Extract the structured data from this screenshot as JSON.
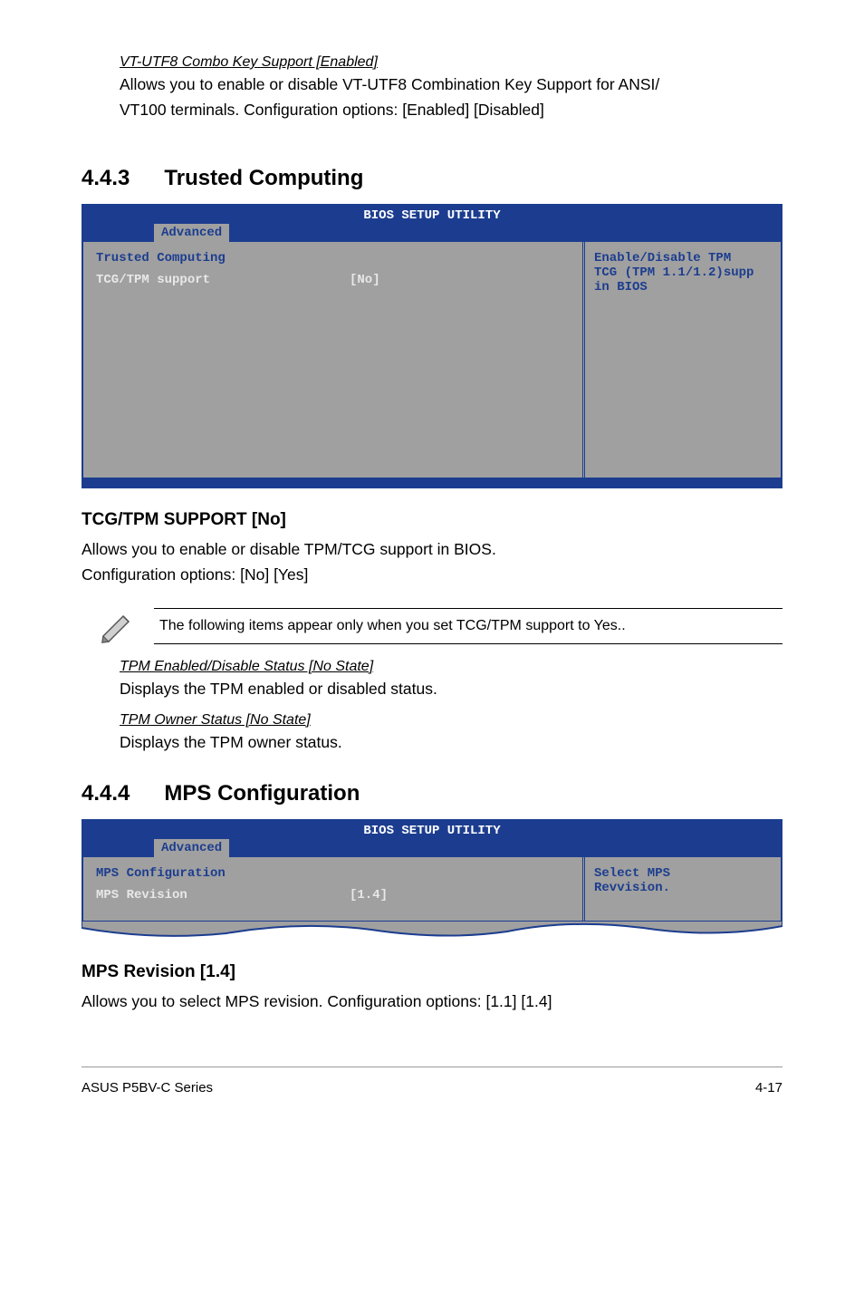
{
  "intro": {
    "heading": "VT-UTF8 Combo Key Support [Enabled]",
    "line1": "Allows you to enable or disable VT-UTF8 Combination Key Support for ANSI/",
    "line2": "VT100 terminals. Configuration options: [Enabled] [Disabled]"
  },
  "sec443": {
    "number": "4.4.3",
    "title": "Trusted Computing",
    "bios": {
      "header": "BIOS SETUP UTILITY",
      "tab": "Advanced",
      "section_title": "Trusted Computing",
      "row_key": "TCG/TPM support",
      "row_val": "[No]",
      "help1": "Enable/Disable TPM",
      "help2": "TCG (TPM 1.1/1.2)supp",
      "help3": "in BIOS"
    },
    "sub_title": "TCG/TPM SUPPORT [No]",
    "body1": "Allows you to enable or disable TPM/TCG support in BIOS.",
    "body2": "Configuration options: [No] [Yes]",
    "note": "The following items appear only when you set TCG/TPM support to Yes..",
    "tpm1_head": "TPM Enabled/Disable Status [No State]",
    "tpm1_body": "Displays the TPM enabled or disabled status.",
    "tpm2_head": "TPM Owner Status [No State]",
    "tpm2_body": "Displays the TPM owner status."
  },
  "sec444": {
    "number": "4.4.4",
    "title": "MPS Configuration",
    "bios": {
      "header": "BIOS SETUP UTILITY",
      "tab": "Advanced",
      "section_title": "MPS Configuration",
      "row_key": "MPS Revision",
      "row_val": "[1.4]",
      "help1": "Select MPS",
      "help2": "Revvision."
    },
    "sub_title": "MPS Revision [1.4]",
    "body1": "Allows you to select MPS revision. Configuration options: [1.1] [1.4]"
  },
  "footer": {
    "left": "ASUS P5BV-C Series",
    "right": "4-17"
  }
}
